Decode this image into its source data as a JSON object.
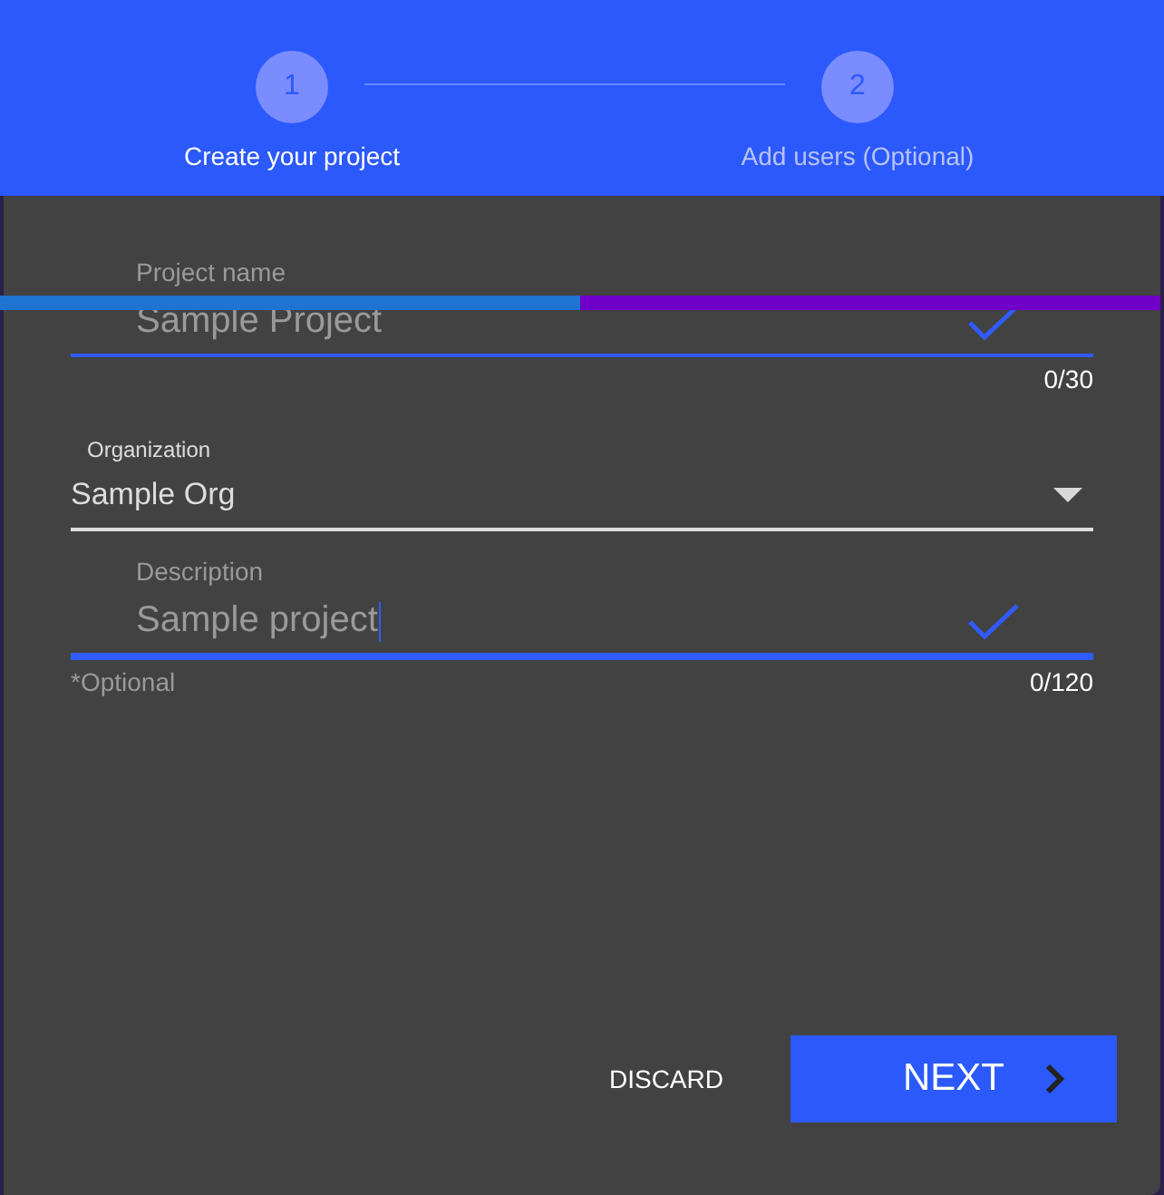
{
  "stepper": {
    "steps": [
      {
        "number": "1",
        "label": "Create your project",
        "selected": true
      },
      {
        "number": "2",
        "label": "Add users (Optional)",
        "selected": false
      }
    ]
  },
  "progress": {
    "level": 0.5
  },
  "fields": [
    {
      "kind": "text",
      "label": "Project name",
      "value": "Sample Project",
      "valid": true,
      "focused": false,
      "counter": "0/30"
    },
    {
      "kind": "select",
      "label": "Organization",
      "value": "Sample Org"
    },
    {
      "kind": "text",
      "label": "Description",
      "value": "Sample project",
      "valid": true,
      "focused": true,
      "hint": "*Optional",
      "counter": "0/120"
    }
  ],
  "buttons": [
    {
      "label": "DISCARD",
      "kind": "flat"
    },
    {
      "label": "NEXT",
      "kind": "primary"
    }
  ]
}
